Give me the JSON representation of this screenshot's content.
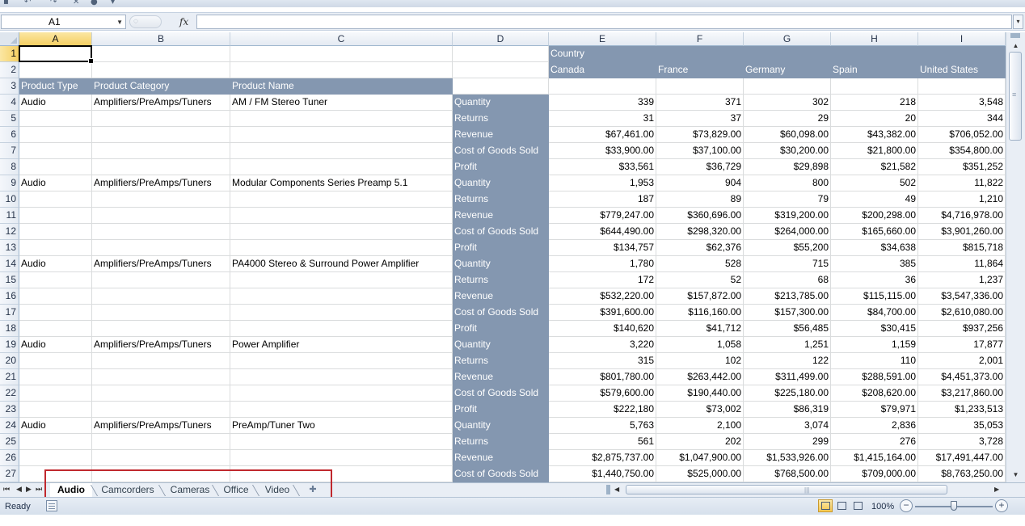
{
  "app": {
    "name_box": {
      "value": "A1"
    },
    "formula": {
      "fx": "fx",
      "value": ""
    },
    "status": {
      "ready": "Ready",
      "zoom": "100%",
      "zoom_fraction": 0.5
    }
  },
  "sheet": {
    "columns": [
      "A",
      "B",
      "C",
      "D",
      "E",
      "F",
      "G",
      "H",
      "I"
    ],
    "row_numbers": [
      "1",
      "2",
      "3",
      "4",
      "5",
      "6",
      "7",
      "8",
      "9",
      "10",
      "11",
      "12",
      "13",
      "14",
      "15",
      "16",
      "17",
      "18",
      "19",
      "20",
      "21",
      "22",
      "23",
      "24",
      "25",
      "26",
      "27"
    ],
    "selected_cell": "A1",
    "header": {
      "country_label": "Country",
      "countries": [
        "Canada",
        "France",
        "Germany",
        "Spain",
        "United States"
      ],
      "row_labels": [
        "Product Type",
        "Product Category",
        "Product Name"
      ]
    },
    "products": [
      {
        "type": "Audio",
        "category": "Amplifiers/PreAmps/Tuners",
        "name": "AM / FM Stereo Tuner"
      },
      {
        "type": "Audio",
        "category": "Amplifiers/PreAmps/Tuners",
        "name": "Modular Components Series Preamp 5.1"
      },
      {
        "type": "Audio",
        "category": "Amplifiers/PreAmps/Tuners",
        "name": "PA4000 Stereo & Surround Power Amplifier"
      },
      {
        "type": "Audio",
        "category": "Amplifiers/PreAmps/Tuners",
        "name": "Power Amplifier"
      },
      {
        "type": "Audio",
        "category": "Amplifiers/PreAmps/Tuners",
        "name": "PreAmp/Tuner Two"
      }
    ],
    "rows": [
      {
        "measure": "Quantity",
        "values": [
          "339",
          "371",
          "302",
          "218",
          "3,548"
        ]
      },
      {
        "measure": "Returns",
        "values": [
          "31",
          "37",
          "29",
          "20",
          "344"
        ]
      },
      {
        "measure": "Revenue",
        "values": [
          "$67,461.00",
          "$73,829.00",
          "$60,098.00",
          "$43,382.00",
          "$706,052.00"
        ]
      },
      {
        "measure": "Cost of Goods Sold",
        "values": [
          "$33,900.00",
          "$37,100.00",
          "$30,200.00",
          "$21,800.00",
          "$354,800.00"
        ]
      },
      {
        "measure": "Profit",
        "values": [
          "$33,561",
          "$36,729",
          "$29,898",
          "$21,582",
          "$351,252"
        ]
      },
      {
        "measure": "Quantity",
        "values": [
          "1,953",
          "904",
          "800",
          "502",
          "11,822"
        ]
      },
      {
        "measure": "Returns",
        "values": [
          "187",
          "89",
          "79",
          "49",
          "1,210"
        ]
      },
      {
        "measure": "Revenue",
        "values": [
          "$779,247.00",
          "$360,696.00",
          "$319,200.00",
          "$200,298.00",
          "$4,716,978.00"
        ]
      },
      {
        "measure": "Cost of Goods Sold",
        "values": [
          "$644,490.00",
          "$298,320.00",
          "$264,000.00",
          "$165,660.00",
          "$3,901,260.00"
        ]
      },
      {
        "measure": "Profit",
        "values": [
          "$134,757",
          "$62,376",
          "$55,200",
          "$34,638",
          "$815,718"
        ]
      },
      {
        "measure": "Quantity",
        "values": [
          "1,780",
          "528",
          "715",
          "385",
          "11,864"
        ]
      },
      {
        "measure": "Returns",
        "values": [
          "172",
          "52",
          "68",
          "36",
          "1,237"
        ]
      },
      {
        "measure": "Revenue",
        "values": [
          "$532,220.00",
          "$157,872.00",
          "$213,785.00",
          "$115,115.00",
          "$3,547,336.00"
        ]
      },
      {
        "measure": "Cost of Goods Sold",
        "values": [
          "$391,600.00",
          "$116,160.00",
          "$157,300.00",
          "$84,700.00",
          "$2,610,080.00"
        ]
      },
      {
        "measure": "Profit",
        "values": [
          "$140,620",
          "$41,712",
          "$56,485",
          "$30,415",
          "$937,256"
        ]
      },
      {
        "measure": "Quantity",
        "values": [
          "3,220",
          "1,058",
          "1,251",
          "1,159",
          "17,877"
        ]
      },
      {
        "measure": "Returns",
        "values": [
          "315",
          "102",
          "122",
          "110",
          "2,001"
        ]
      },
      {
        "measure": "Revenue",
        "values": [
          "$801,780.00",
          "$263,442.00",
          "$311,499.00",
          "$288,591.00",
          "$4,451,373.00"
        ]
      },
      {
        "measure": "Cost of Goods Sold",
        "values": [
          "$579,600.00",
          "$190,440.00",
          "$225,180.00",
          "$208,620.00",
          "$3,217,860.00"
        ]
      },
      {
        "measure": "Profit",
        "values": [
          "$222,180",
          "$73,002",
          "$86,319",
          "$79,971",
          "$1,233,513"
        ]
      },
      {
        "measure": "Quantity",
        "values": [
          "5,763",
          "2,100",
          "3,074",
          "2,836",
          "35,053"
        ]
      },
      {
        "measure": "Returns",
        "values": [
          "561",
          "202",
          "299",
          "276",
          "3,728"
        ]
      },
      {
        "measure": "Revenue",
        "values": [
          "$2,875,737.00",
          "$1,047,900.00",
          "$1,533,926.00",
          "$1,415,164.00",
          "$17,491,447.00"
        ]
      },
      {
        "measure": "Cost of Goods Sold",
        "values": [
          "$1,440,750.00",
          "$525,000.00",
          "$768,500.00",
          "$709,000.00",
          "$8,763,250.00"
        ]
      }
    ],
    "sheet_tabs": [
      {
        "label": "Audio",
        "active": true
      },
      {
        "label": "Camcorders",
        "active": false
      },
      {
        "label": "Cameras",
        "active": false
      },
      {
        "label": "Office",
        "active": false
      },
      {
        "label": "Video",
        "active": false
      }
    ]
  },
  "colors": {
    "header_fill": "#8497b0",
    "selection_highlight": "#f5cf63",
    "callout_border": "#c0282e"
  }
}
